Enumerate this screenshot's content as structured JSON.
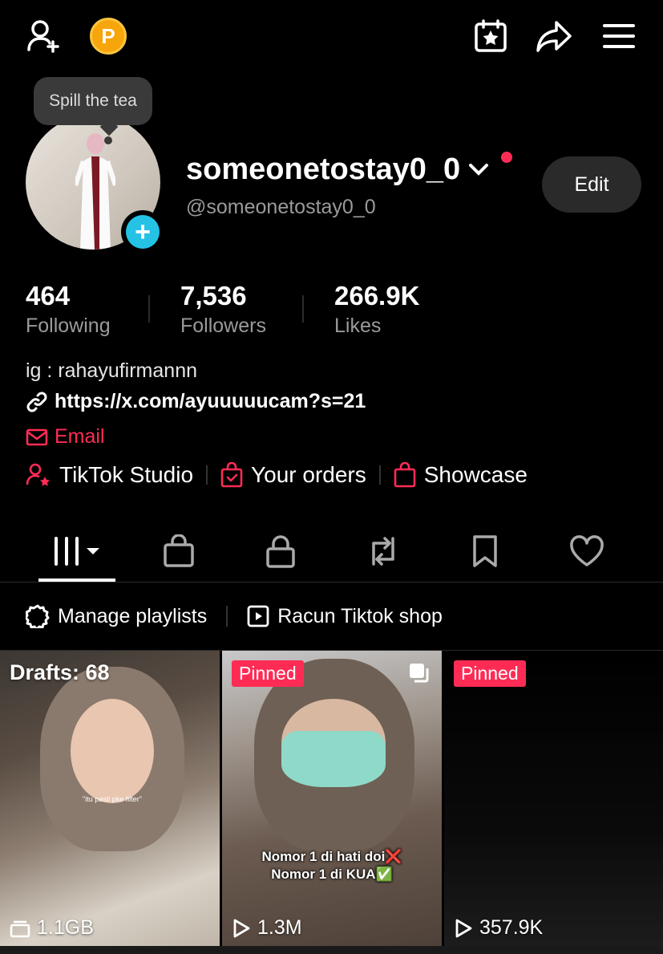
{
  "tooltip": {
    "text": "Spill the tea"
  },
  "profile": {
    "display_name": "someonetostay0_0",
    "handle": "@someonetostay0_0",
    "edit_label": "Edit",
    "bio": "ig : rahayufirmannn",
    "link": "https://x.com/ayuuuuucam?s=21",
    "email_label": "Email"
  },
  "stats": [
    {
      "value": "464",
      "label": "Following"
    },
    {
      "value": "7,536",
      "label": "Followers"
    },
    {
      "value": "266.9K",
      "label": "Likes"
    }
  ],
  "tools": [
    {
      "label": "TikTok Studio",
      "icon": "person-star-icon"
    },
    {
      "label": "Your orders",
      "icon": "bag-check-icon"
    },
    {
      "label": "Showcase",
      "icon": "bag-icon"
    }
  ],
  "tabs": [
    "videos-grid-icon",
    "shop-bag-icon",
    "lock-icon",
    "repost-icon",
    "bookmark-icon",
    "heart-icon"
  ],
  "playlists": [
    {
      "label": "Manage playlists",
      "icon": "gear-icon"
    },
    {
      "label": "Racun Tiktok shop",
      "icon": "play-square-icon"
    }
  ],
  "videos": [
    {
      "overlay": "Drafts: 68",
      "meta": "1.1GB",
      "caption": "\"itu pasti pke filter\""
    },
    {
      "badge": "Pinned",
      "meta": "1.3M",
      "caption_line1": "Nomor 1 di hati doi❌",
      "caption_line2": "Nomor 1 di KUA✅"
    },
    {
      "badge": "Pinned",
      "meta": "357.9K"
    }
  ],
  "colors": {
    "accent": "#fe2c55",
    "add_button": "#25c2e6",
    "coin": "#f6a50b"
  }
}
